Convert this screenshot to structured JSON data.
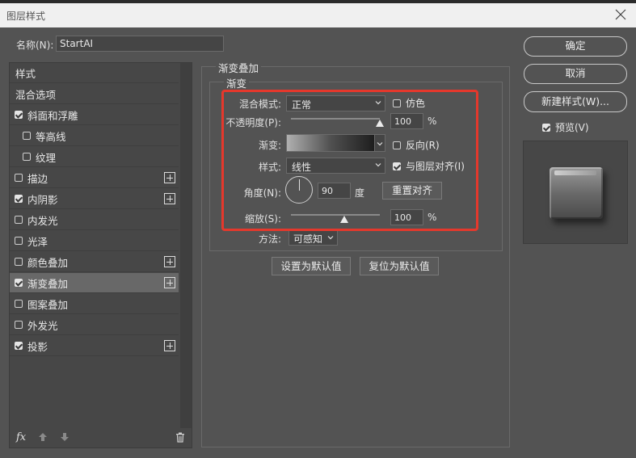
{
  "window": {
    "title": "图层样式"
  },
  "name_field": {
    "label": "名称(N):",
    "value": "StartAI"
  },
  "sidebar": {
    "header": "样式",
    "blend_options": "混合选项",
    "items": [
      {
        "label": "斜面和浮雕",
        "checked": true,
        "indent": false,
        "plus": false,
        "selected": false
      },
      {
        "label": "等高线",
        "checked": false,
        "indent": true,
        "plus": false,
        "selected": false
      },
      {
        "label": "纹理",
        "checked": false,
        "indent": true,
        "plus": false,
        "selected": false
      },
      {
        "label": "描边",
        "checked": false,
        "indent": false,
        "plus": true,
        "selected": false
      },
      {
        "label": "内阴影",
        "checked": true,
        "indent": false,
        "plus": true,
        "selected": false
      },
      {
        "label": "内发光",
        "checked": false,
        "indent": false,
        "plus": false,
        "selected": false
      },
      {
        "label": "光泽",
        "checked": false,
        "indent": false,
        "plus": false,
        "selected": false
      },
      {
        "label": "颜色叠加",
        "checked": false,
        "indent": false,
        "plus": true,
        "selected": false
      },
      {
        "label": "渐变叠加",
        "checked": true,
        "indent": false,
        "plus": true,
        "selected": true
      },
      {
        "label": "图案叠加",
        "checked": false,
        "indent": false,
        "plus": false,
        "selected": false
      },
      {
        "label": "外发光",
        "checked": false,
        "indent": false,
        "plus": false,
        "selected": false
      },
      {
        "label": "投影",
        "checked": true,
        "indent": false,
        "plus": true,
        "selected": false
      }
    ],
    "footer": {
      "fx": "fx"
    }
  },
  "panel": {
    "title": "渐变叠加",
    "subtitle": "渐变",
    "blend_mode": {
      "label": "混合模式:",
      "value": "正常"
    },
    "dither": {
      "label": "仿色",
      "checked": false
    },
    "opacity": {
      "label": "不透明度(P):",
      "value": "100",
      "unit": "%",
      "fraction": 1.0
    },
    "gradient": {
      "label": "渐变:",
      "colors": [
        "#b0b0b0",
        "#505050",
        "#1e1e1e"
      ]
    },
    "reverse": {
      "label": "反向(R)",
      "checked": false
    },
    "style": {
      "label": "样式:",
      "value": "线性"
    },
    "align_layer": {
      "label": "与图层对齐(I)",
      "checked": true
    },
    "angle": {
      "label": "角度(N):",
      "value": "90",
      "unit": "度"
    },
    "reset_align": "重置对齐",
    "scale": {
      "label": "缩放(S):",
      "value": "100",
      "unit": "%",
      "fraction": 0.6
    },
    "method": {
      "label": "方法:",
      "value": "可感知"
    },
    "set_default": "设置为默认值",
    "reset_default": "复位为默认值"
  },
  "actions": {
    "ok": "确定",
    "cancel": "取消",
    "new_style": "新建样式(W)...",
    "preview": {
      "label": "预览(V)",
      "checked": true
    }
  },
  "colors": {
    "highlight": "#e5382c",
    "background": "#535353"
  }
}
